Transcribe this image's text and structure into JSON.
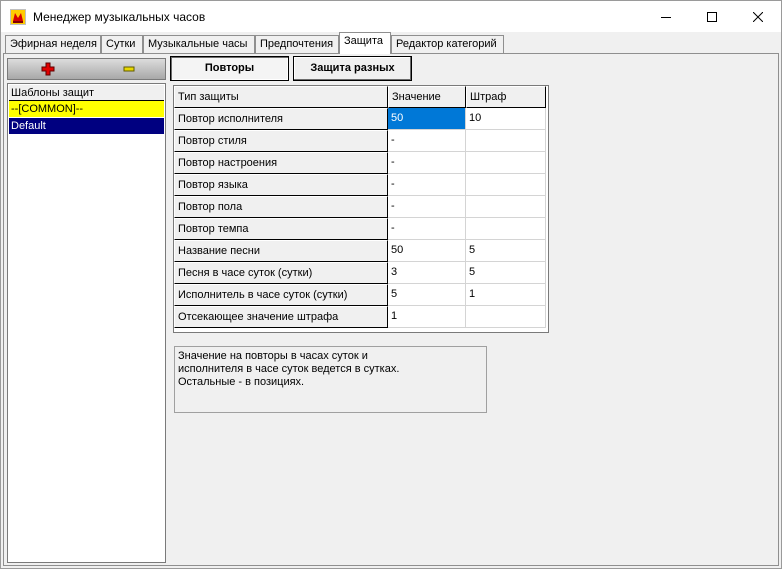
{
  "window": {
    "title": "Менеджер музыкальных часов",
    "controls": {
      "minimize": "minimize-icon",
      "maximize": "maximize-icon",
      "close": "close-icon"
    }
  },
  "tabs": [
    {
      "label": "Эфирная неделя",
      "active": false
    },
    {
      "label": "Сутки",
      "active": false
    },
    {
      "label": "Музыкальные часы",
      "active": false
    },
    {
      "label": "Предпочтения",
      "active": false
    },
    {
      "label": "Защита",
      "active": true
    },
    {
      "label": "Редактор категорий",
      "active": false
    }
  ],
  "left_toolbar": {
    "add_icon": "plus-icon",
    "remove_icon": "minus-icon"
  },
  "templates": {
    "header": "Шаблоны защит",
    "items": [
      {
        "label": "--[COMMON]--",
        "style": "yellow"
      },
      {
        "label": "Default",
        "style": "selected"
      }
    ]
  },
  "mode_buttons": {
    "repeats": "Повторы",
    "protection": "Защита разных"
  },
  "grid": {
    "columns": [
      "Тип защиты",
      "Значение",
      "Штраф"
    ],
    "rows": [
      {
        "type": "Повтор исполнителя",
        "value": "50",
        "penalty": "10"
      },
      {
        "type": "Повтор стиля",
        "value": "-",
        "penalty": ""
      },
      {
        "type": "Повтор настроения",
        "value": "-",
        "penalty": ""
      },
      {
        "type": "Повтор языка",
        "value": "-",
        "penalty": ""
      },
      {
        "type": "Повтор пола",
        "value": "-",
        "penalty": ""
      },
      {
        "type": "Повтор темпа",
        "value": "-",
        "penalty": ""
      },
      {
        "type": "Название песни",
        "value": "50",
        "penalty": "5"
      },
      {
        "type": "Песня в часе суток (сутки)",
        "value": "3",
        "penalty": "5"
      },
      {
        "type": "Исполнитель в часе суток (сутки)",
        "value": "5",
        "penalty": "1"
      },
      {
        "type": "Отсекающее значение штрафа",
        "value": "1",
        "penalty": ""
      }
    ]
  },
  "memo": {
    "lines": [
      "Значение на повторы в часах суток и",
      "исполнителя в часе суток ведется в сутках.",
      "Остальные - в позициях."
    ]
  },
  "colors": {
    "selection": "#0078d7",
    "template_selected": "#000080",
    "template_common": "#ffff00"
  }
}
